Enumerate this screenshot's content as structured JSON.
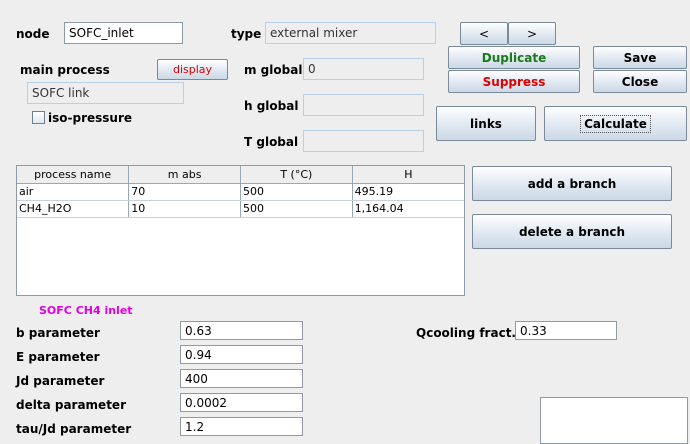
{
  "node": {
    "label": "node",
    "value": "SOFC_inlet"
  },
  "type": {
    "label": "type",
    "value": "external mixer"
  },
  "nav": {
    "prev": "<",
    "next": ">"
  },
  "actions": {
    "duplicate": "Duplicate",
    "suppress": "Suppress",
    "save": "Save",
    "close": "Close",
    "links": "links",
    "calculate": "Calculate",
    "add_branch": "add a branch",
    "delete_branch": "delete a branch",
    "display": "display"
  },
  "colors": {
    "duplicate": "#1a7a1a",
    "suppress": "#dd0000",
    "display": "#dd0000",
    "section_title": "#e000e0"
  },
  "main_process": {
    "label": "main process",
    "value": "SOFC link"
  },
  "iso_pressure": {
    "label": "iso-pressure",
    "checked": false
  },
  "globals": {
    "m": {
      "label": "m global",
      "value": "0"
    },
    "h": {
      "label": "h global",
      "value": ""
    },
    "T": {
      "label": "T global",
      "value": ""
    }
  },
  "table": {
    "headers": [
      "process name",
      "m abs",
      "T (°C)",
      "H"
    ],
    "rows": [
      [
        "air",
        "70",
        "500",
        "495.19"
      ],
      [
        "CH4_H2O",
        "10",
        "500",
        "1,164.04"
      ]
    ]
  },
  "section_title": "SOFC CH4 inlet",
  "params": {
    "b": {
      "label": "b parameter",
      "value": "0.63"
    },
    "E": {
      "label": "E parameter",
      "value": "0.94"
    },
    "Jd": {
      "label": "Jd parameter",
      "value": "400"
    },
    "delta": {
      "label": "delta parameter",
      "value": "0.0002"
    },
    "tauJd": {
      "label": "tau/Jd parameter",
      "value": "1.2"
    },
    "qcooling": {
      "label": "Qcooling fract.",
      "value": "0.33"
    }
  }
}
